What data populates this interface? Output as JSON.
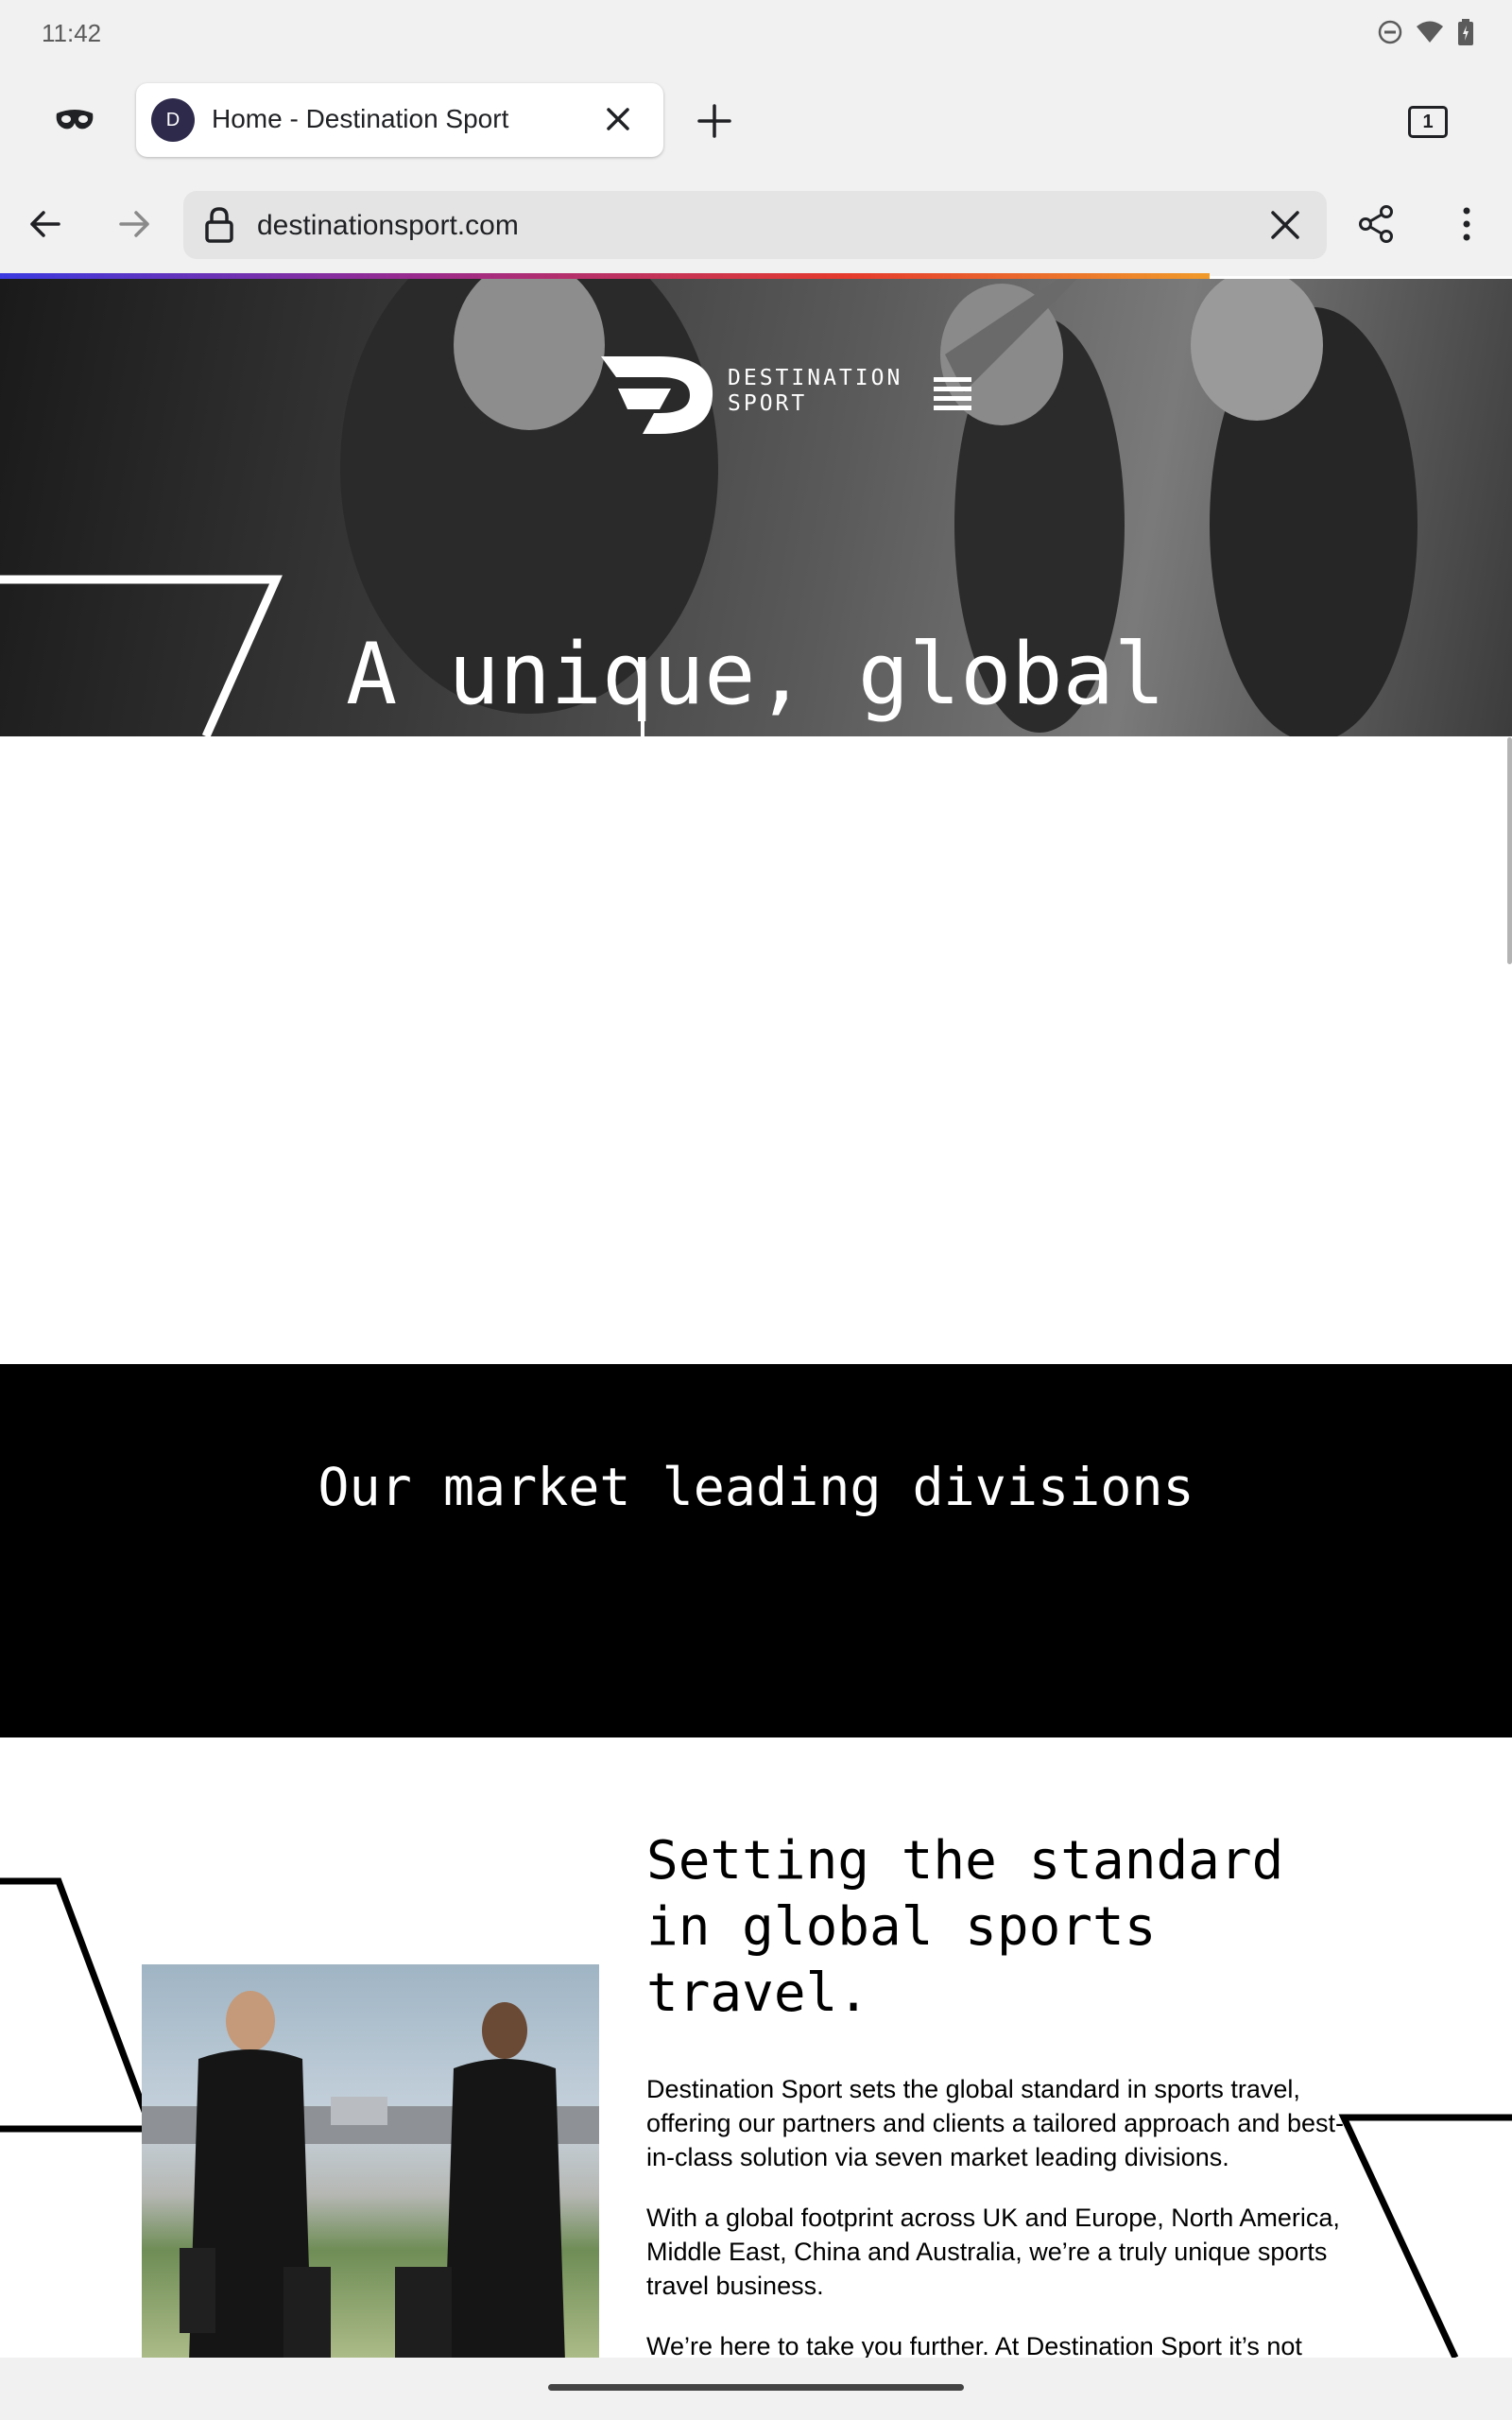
{
  "status": {
    "time": "11:42"
  },
  "browser": {
    "tab": {
      "favicon_letter": "D",
      "title": "Home - Destination Sport"
    },
    "tab_count": "1",
    "url": "destinationsport.com",
    "load_progress_percent": 80
  },
  "hero": {
    "brand_line1": "DESTINATION",
    "brand_line2": "SPORT",
    "headline": "A unique, global"
  },
  "divisions": {
    "heading": "Our market leading divisions"
  },
  "about": {
    "title": "Setting the standard in global sports travel.",
    "paragraphs": [
      "Destination Sport sets the global standard in sports travel, offering our partners and clients a tailored approach and best-in-class solution via seven market leading divisions.",
      "With a global footprint across UK and Europe, North America, Middle East, China and Australia, we’re a truly unique sports travel business.",
      "We’re here to take you further. At Destination Sport it’s not"
    ]
  },
  "icons": {
    "incognito": "incognito-icon",
    "close_tab": "close-icon",
    "new_tab": "plus-icon",
    "back": "arrow-left-icon",
    "forward": "arrow-right-icon",
    "lock": "lock-icon",
    "clear": "close-icon",
    "share": "share-icon",
    "menu": "more-vert-icon",
    "site_menu": "hamburger-icon"
  }
}
